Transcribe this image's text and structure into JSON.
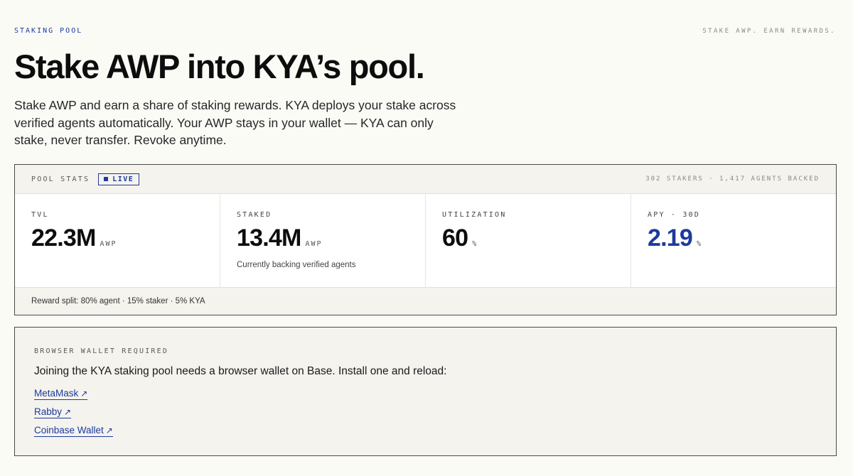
{
  "header": {
    "eyebrow": "STAKING POOL",
    "tagline": "STAKE AWP. EARN REWARDS.",
    "title": "Stake AWP into KYA’s pool.",
    "intro": "Stake AWP and earn a share of staking rewards. KYA deploys your stake across verified agents automatically. Your AWP stays in your wallet — KYA can only stake, never transfer. Revoke anytime."
  },
  "pool_stats": {
    "label": "POOL STATS",
    "live_badge": "LIVE",
    "meta": "302 STAKERS · 1,417 AGENTS BACKED",
    "stats": [
      {
        "label": "TVL",
        "value": "22.3M",
        "unit": "AWP",
        "note": ""
      },
      {
        "label": "STAKED",
        "value": "13.4M",
        "unit": "AWP",
        "note": "Currently backing verified agents"
      },
      {
        "label": "UTILIZATION",
        "value": "60",
        "unit": "%",
        "note": ""
      },
      {
        "label": "APY · 30D",
        "value": "2.19",
        "unit": "%",
        "note": ""
      }
    ],
    "footer": "Reward split: 80% agent · 15% staker · 5% KYA"
  },
  "wallet": {
    "label": "BROWSER WALLET REQUIRED",
    "text": "Joining the KYA staking pool needs a browser wallet on Base. Install one and reload:",
    "links": [
      {
        "label": "MetaMask",
        "arrow": "↗"
      },
      {
        "label": "Rabby",
        "arrow": "↗"
      },
      {
        "label": "Coinbase Wallet",
        "arrow": "↗"
      }
    ]
  },
  "colors": {
    "accent": "#1e3a9c",
    "background": "#fbfbf6",
    "panel": "#f4f3ee"
  }
}
